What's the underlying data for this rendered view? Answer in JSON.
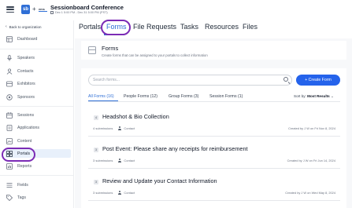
{
  "app": {
    "logo_mark": "sb",
    "logo_text": "ems",
    "conference_title": "Sessionboard Conference",
    "conference_dates": "Dec 1 5:00 PM - Dec 31 5:00 PM (PST)"
  },
  "sidebar": {
    "back_label": "Back to organization",
    "items": [
      {
        "label": "Dashboard",
        "icon": "dashboard-icon"
      },
      {
        "label": "Speakers",
        "icon": "microphone-icon"
      },
      {
        "label": "Contacts",
        "icon": "contacts-icon"
      },
      {
        "label": "Exhibitors",
        "icon": "exhibitor-icon"
      },
      {
        "label": "Sponsors",
        "icon": "sponsor-icon"
      },
      {
        "label": "Sessions",
        "icon": "sessions-icon"
      },
      {
        "label": "Applications",
        "icon": "applications-icon"
      },
      {
        "label": "Content",
        "icon": "content-icon"
      },
      {
        "label": "Portals",
        "icon": "portals-icon",
        "active": true
      },
      {
        "label": "Reports",
        "icon": "reports-icon"
      },
      {
        "label": "Fields",
        "icon": "fields-icon"
      },
      {
        "label": "Tags",
        "icon": "tag-icon"
      }
    ]
  },
  "tabs": [
    "Portals",
    "Forms",
    "File Requests",
    "Tasks",
    "Resources",
    "Files"
  ],
  "active_tab": "Forms",
  "forms_header": {
    "title": "Forms",
    "subtitle": "Create forms that can be assigned to your portals to collect information"
  },
  "search": {
    "placeholder": "Search forms..."
  },
  "create_button": "+ Create Form",
  "filter_tabs": [
    "All Forms (16)",
    "People Forms (12)",
    "Group Forms (3)",
    "Session Forms (1)"
  ],
  "sort": {
    "label": "Sort by:",
    "value": "Most Results",
    "arrow": "⌄"
  },
  "forms": [
    {
      "num": "4",
      "title": "Headshot & Bio Collection",
      "submissions": "4 submissions",
      "type": "Contact",
      "created": "Created by J W on Fri Nov 8, 2024"
    },
    {
      "num": "3",
      "title": "Post Event: Please share any receipts for reimbursement",
      "submissions": "3 submissions",
      "type": "Contact",
      "created": "Created by J W on Fri Jun 14, 2024"
    },
    {
      "num": "3",
      "title": "Review and Update your Contact Information",
      "submissions": "3 submissions",
      "type": "Contact",
      "created": "Created by J W on Wed May 8, 2024"
    }
  ],
  "colors": {
    "accent": "#2f6fd6",
    "button": "#2563eb",
    "highlight_ring": "#7b2bb5",
    "active_nav_bg": "#e8f0fb"
  }
}
